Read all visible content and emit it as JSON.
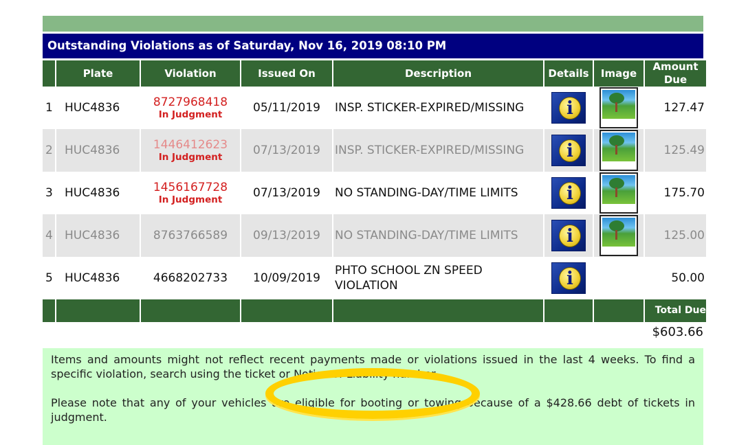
{
  "title": "Outstanding Violations as of Saturday, Nov 16, 2019 08:10 PM",
  "columns": [
    "",
    "Plate",
    "Violation",
    "Issued On",
    "Description",
    "Details",
    "Image",
    "Amount Due"
  ],
  "rows": [
    {
      "num": "1",
      "plate": "HUC4836",
      "violation": "8727968418",
      "status": "In Judgment",
      "issued": "05/11/2019",
      "description": "INSP. STICKER-EXPIRED/MISSING",
      "details_icon": "info-icon",
      "image_icon": "photo-thumbnail-icon",
      "amount": "127.47"
    },
    {
      "num": "2",
      "plate": "HUC4836",
      "violation": "1446412623",
      "status": "In Judgment",
      "issued": "07/13/2019",
      "description": "INSP. STICKER-EXPIRED/MISSING",
      "details_icon": "info-icon",
      "image_icon": "photo-thumbnail-icon",
      "amount": "125.49"
    },
    {
      "num": "3",
      "plate": "HUC4836",
      "violation": "1456167728",
      "status": "In Judgment",
      "issued": "07/13/2019",
      "description": "NO STANDING-DAY/TIME LIMITS",
      "details_icon": "info-icon",
      "image_icon": "photo-thumbnail-icon",
      "amount": "175.70"
    },
    {
      "num": "4",
      "plate": "HUC4836",
      "violation": "8763766589",
      "status": "",
      "issued": "09/13/2019",
      "description": "NO STANDING-DAY/TIME LIMITS",
      "details_icon": "info-icon",
      "image_icon": "photo-thumbnail-icon",
      "amount": "125.00"
    },
    {
      "num": "5",
      "plate": "HUC4836",
      "violation": "4668202733",
      "status": "",
      "issued": "10/09/2019",
      "description": "PHTO SCHOOL ZN SPEED VIOLATION",
      "details_icon": "info-icon",
      "image_icon": "",
      "amount": "50.00"
    }
  ],
  "total": {
    "label": "Total Due",
    "value": "$603.66"
  },
  "notice": {
    "p1": "Items and amounts might not reflect recent payments made or violations issued in the last 4 weeks. To find a specific violation, search using the ticket or Notice of Liability number.",
    "p2": "Please note that any of your vehicles are eligible for booting or towing because of a $428.66 debt of tickets in judgment."
  },
  "colors": {
    "title_bg": "#000080",
    "header_bg": "#336633",
    "top_bar": "#86b886",
    "notice_bg": "#ccffcc",
    "judgment_red": "#d32020",
    "annotation": "#ffd000"
  }
}
